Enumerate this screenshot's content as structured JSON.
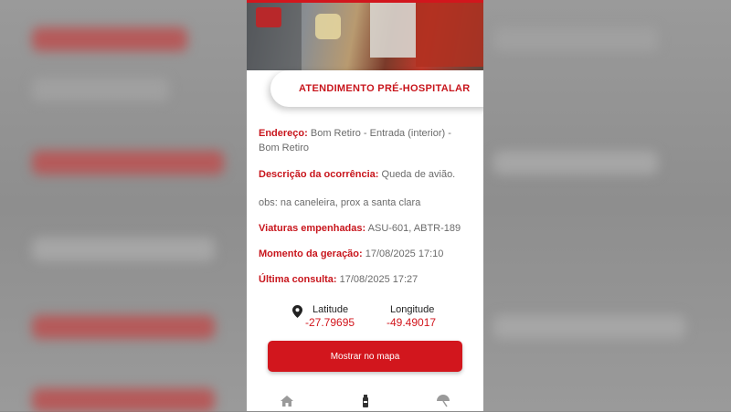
{
  "card": {
    "title": "ATENDIMENTO PRÉ-HOSPITALAR"
  },
  "details": {
    "address_label": "Endereço:",
    "address_value": "Bom Retiro - Entrada (interior) - Bom Retiro",
    "description_label": "Descrição da ocorrência:",
    "description_value": "Queda de avião.",
    "obs": "obs: na caneleira, prox a santa clara",
    "vehicles_label": "Viaturas empenhadas:",
    "vehicles_value": "ASU-601, ABTR-189",
    "generated_label": "Momento da geração:",
    "generated_value": "17/08/2025 17:10",
    "last_query_label": "Última consulta:",
    "last_query_value": "17/08/2025 17:27"
  },
  "location": {
    "latitude_label": "Latitude",
    "latitude_value": "-27.79695",
    "longitude_label": "Longitude",
    "longitude_value": "-49.49017",
    "pin_icon": "map-pin-icon"
  },
  "actions": {
    "show_map_label": "Mostrar no mapa"
  },
  "nav": {
    "items": [
      "home-icon",
      "fire-extinguisher-icon",
      "umbrella-icon"
    ]
  },
  "colors": {
    "accent": "#d2161d",
    "text": "#6b6b6b"
  }
}
